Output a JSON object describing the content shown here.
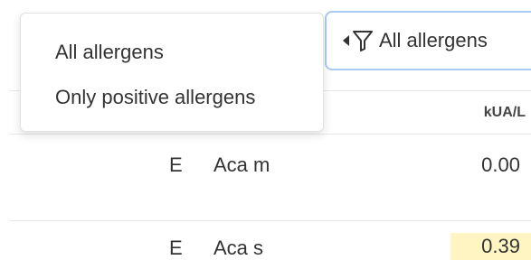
{
  "filter": {
    "button_label": "All allergens",
    "options": [
      {
        "label": "All allergens"
      },
      {
        "label": "Only positive allergens"
      }
    ]
  },
  "table": {
    "unit_header": "kUA/L",
    "rows": [
      {
        "class": "E",
        "allergen": "Aca m",
        "value": "0.00",
        "highlighted": false
      },
      {
        "class": "E",
        "allergen": "Aca s",
        "value": "0.39",
        "highlighted": true
      }
    ]
  },
  "colors": {
    "button_border": "#a9cdf2",
    "highlight": "#fff5c2"
  },
  "icons": {
    "filter": "filter-funnel-icon",
    "caret": "caret-left-icon"
  }
}
